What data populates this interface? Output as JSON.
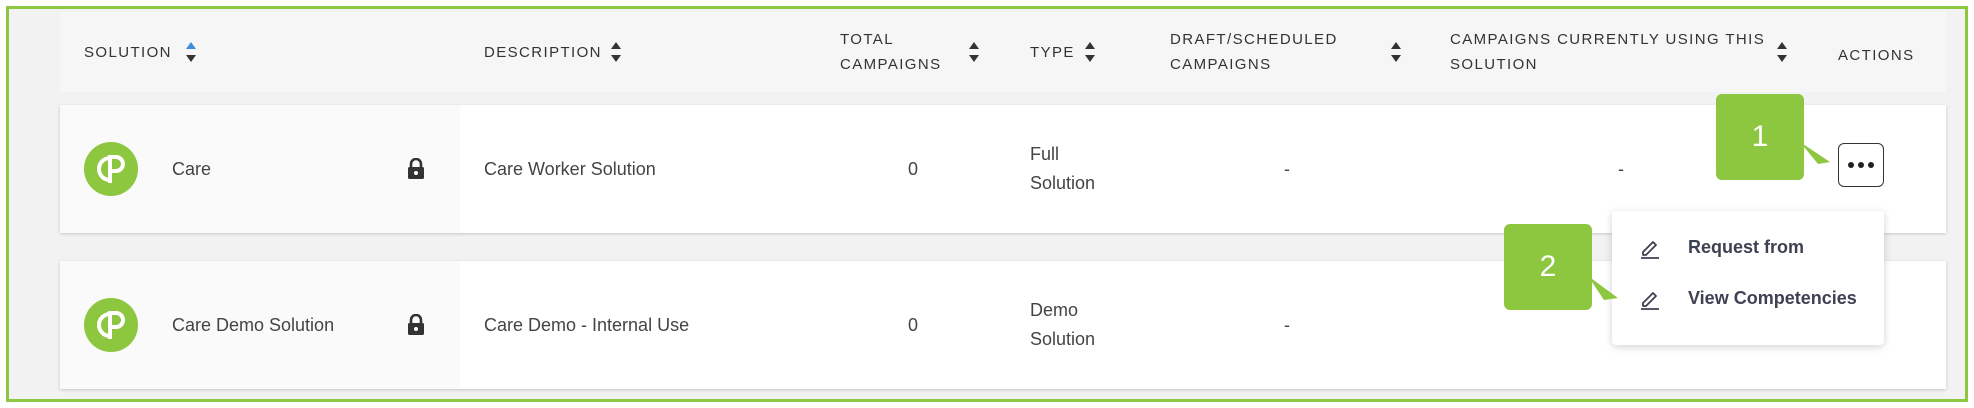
{
  "headers": {
    "solution": "SOLUTION",
    "description": "DESCRIPTION",
    "total_campaigns_line1": "TOTAL",
    "total_campaigns_line2": "CAMPAIGNS",
    "type": "TYPE",
    "draft_line1": "DRAFT/SCHEDULED",
    "draft_line2": "CAMPAIGNS",
    "currently_line1": "CAMPAIGNS CURRENTLY USING THIS",
    "currently_line2": "SOLUTION",
    "actions": "ACTIONS"
  },
  "rows": [
    {
      "name": "Care",
      "description": "Care Worker Solution",
      "total_campaigns": "0",
      "type_line1": "Full",
      "type_line2": "Solution",
      "draft": "-",
      "currently_using": "-"
    },
    {
      "name": "Care Demo Solution",
      "description": "Care Demo - Internal Use",
      "total_campaigns": "0",
      "type_line1": "Demo",
      "type_line2": "Solution",
      "draft": "-",
      "currently_using": ""
    }
  ],
  "menu": {
    "items": [
      "Request from",
      "View Competencies"
    ]
  },
  "callouts": [
    "1",
    "2"
  ],
  "colors": {
    "accent_green": "#8dc63f",
    "sort_active_blue": "#3b8fd9",
    "menu_text": "#3d4152"
  },
  "icons": {
    "lock": "lock-icon",
    "logo": "cp-logo-icon",
    "more": "ellipsis-icon",
    "edit": "pencil-icon",
    "sort": "sort-arrows-icon"
  }
}
